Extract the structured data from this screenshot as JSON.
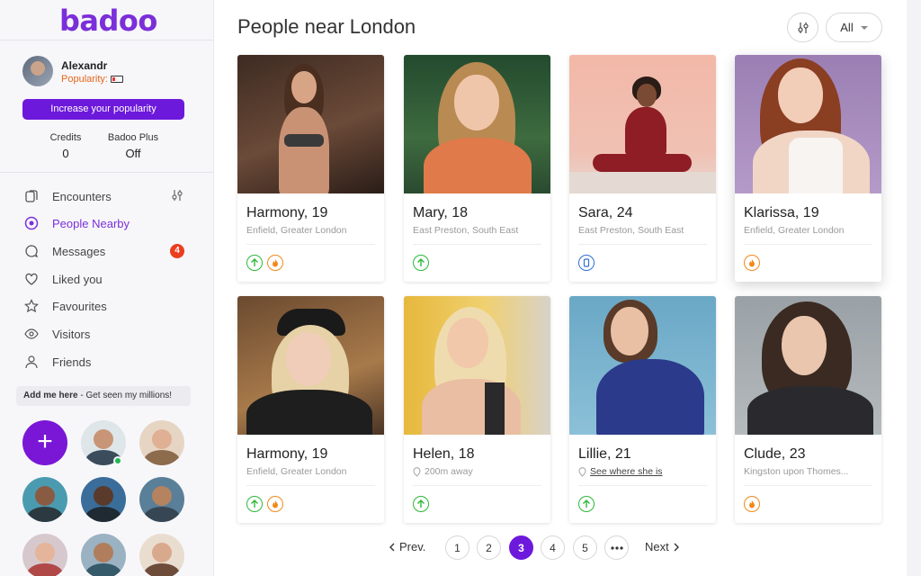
{
  "app": {
    "logo": "badoo",
    "accent": "#6d19dc"
  },
  "profile": {
    "name": "Alexandr",
    "popularity_label": "Popularity:",
    "cta": "Increase your popularity",
    "credits_label": "Credits",
    "credits_value": "0",
    "plus_label": "Badoo Plus",
    "plus_value": "Off"
  },
  "nav": [
    {
      "label": "Encounters",
      "icon": "encounters-icon"
    },
    {
      "label": "People Nearby",
      "icon": "people-nearby-icon",
      "active": true
    },
    {
      "label": "Messages",
      "icon": "messages-icon",
      "badge": "4"
    },
    {
      "label": "Liked you",
      "icon": "heart-icon"
    },
    {
      "label": "Favourites",
      "icon": "star-icon"
    },
    {
      "label": "Visitors",
      "icon": "eye-icon"
    },
    {
      "label": "Friends",
      "icon": "person-icon"
    }
  ],
  "promo": {
    "bold": "Add me here",
    "rest": " - Get seen my millions!"
  },
  "header": {
    "title": "People near London",
    "filter_value": "All"
  },
  "people": [
    {
      "name": "Harmony, 19",
      "location": "Enfield, Greater London",
      "badges": [
        "up",
        "fire"
      ]
    },
    {
      "name": "Mary, 18",
      "location": "East Preston, South East",
      "badges": [
        "up"
      ]
    },
    {
      "name": "Sara, 24",
      "location": "East Preston, South East",
      "badges": [
        "phone"
      ]
    },
    {
      "name": "Klarissa, 19",
      "location": "Enfield, Greater London",
      "badges": [
        "fire"
      ]
    },
    {
      "name": "Harmony, 19",
      "location": "Enfield, Greater London",
      "badges": [
        "up",
        "fire"
      ]
    },
    {
      "name": "Helen, 18",
      "location": "200m away",
      "badges": [
        "up"
      ]
    },
    {
      "name": "Lillie, 21",
      "location": "See where she is",
      "badges": [
        "up"
      ]
    },
    {
      "name": "Clude, 23",
      "location": "Kingston upon Thomes...",
      "badges": [
        "fire"
      ]
    }
  ],
  "pagination": {
    "prev": "Prev.",
    "next": "Next",
    "pages": [
      "1",
      "2",
      "3",
      "4",
      "5"
    ],
    "current": "3"
  }
}
